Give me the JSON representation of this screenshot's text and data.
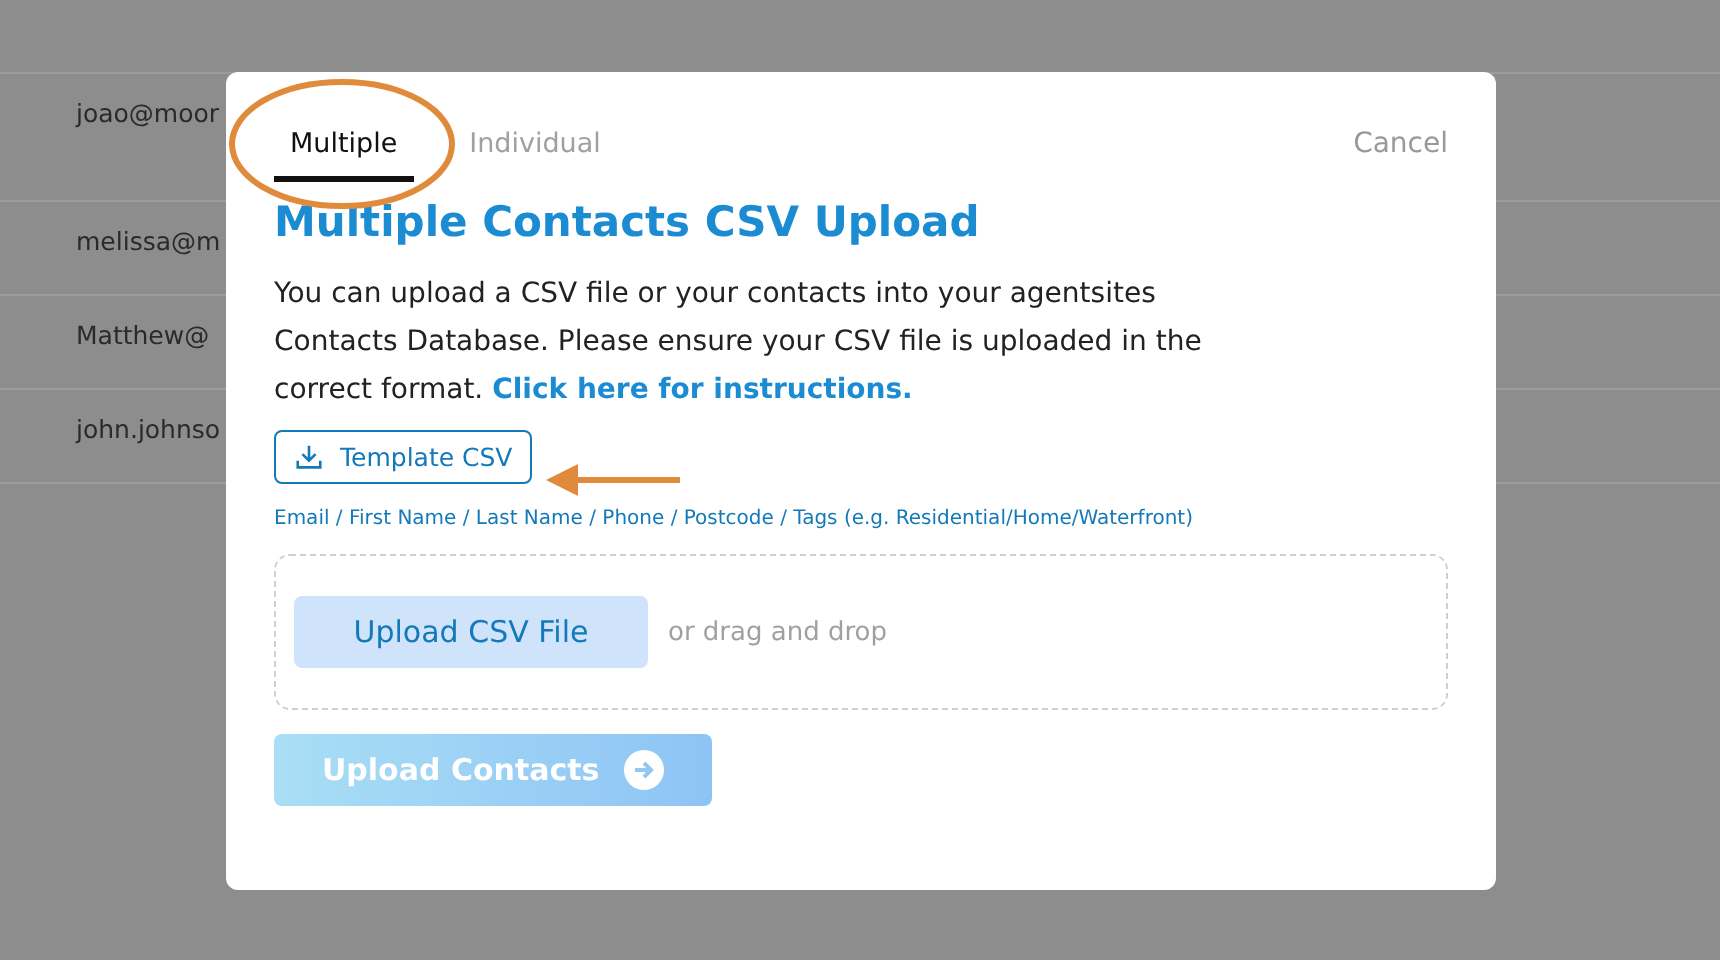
{
  "background_table": {
    "rows": [
      {
        "email": "joao@moor"
      },
      {
        "email": "melissa@m"
      },
      {
        "email": "Matthew@"
      },
      {
        "email": "john.johnso"
      }
    ]
  },
  "dialog": {
    "tabs": [
      {
        "label": "Multiple",
        "selected": true
      },
      {
        "label": "Individual",
        "selected": false
      }
    ],
    "cancel": "Cancel",
    "title": "Multiple Contacts CSV Upload",
    "description": "You can upload a CSV file or your contacts into your agentsites Contacts Database. Please ensure your CSV file is uploaded in the correct format.",
    "instructions_link": "Click here for instructions.",
    "template_button": "Template CSV",
    "fields_hint": "Email / First Name / Last Name / Phone / Postcode / Tags (e.g. Residential/Home/Waterfront)",
    "dropzone": {
      "button": "Upload CSV File",
      "hint": "or drag and drop"
    },
    "submit": {
      "label": "Upload Contacts",
      "disabled": true
    }
  }
}
